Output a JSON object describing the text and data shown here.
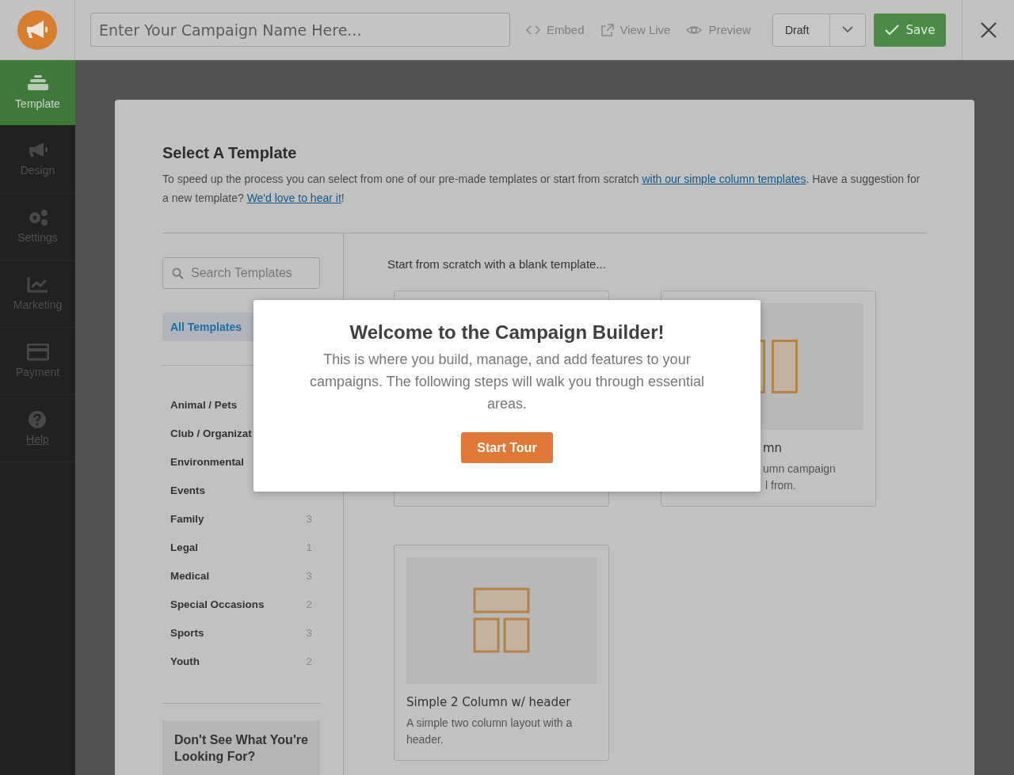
{
  "header": {
    "campaign_name": {
      "placeholder": "Enter Your Campaign Name Here..."
    },
    "actions": [
      {
        "kind": "embed",
        "label": "Embed"
      },
      {
        "kind": "view-live",
        "label": "View Live"
      },
      {
        "kind": "preview",
        "label": "Preview"
      }
    ],
    "status_select": {
      "value": "Draft"
    },
    "save_button": "Save"
  },
  "sidebar": {
    "items": [
      {
        "kind": "template",
        "label": "Template",
        "selected": true
      },
      {
        "kind": "design",
        "label": "Design",
        "selected": false
      },
      {
        "kind": "settings",
        "label": "Settings",
        "selected": false
      },
      {
        "kind": "marketing",
        "label": "Marketing",
        "selected": false
      },
      {
        "kind": "payment",
        "label": "Payment",
        "selected": false
      },
      {
        "kind": "help",
        "label": "Help",
        "selected": false
      }
    ]
  },
  "panel": {
    "title": "Select A Template",
    "intro": [
      {
        "kind": "text",
        "text": "To speed up the process you can select from one of our pre-made templates or start from scratch "
      },
      {
        "kind": "link",
        "text": "with our simple column templates"
      },
      {
        "kind": "text",
        "text": ". Have a suggestion for a new template? "
      },
      {
        "kind": "link",
        "text": "We'd love to hear it"
      },
      {
        "kind": "text",
        "text": "!"
      }
    ],
    "search": {
      "placeholder": "Search Templates"
    },
    "filters": [
      {
        "label": "All Templates",
        "selected": true
      }
    ],
    "categories": [
      {
        "label": "Animal / Pets"
      },
      {
        "label": "Club / Organizat"
      },
      {
        "label": "Environmental"
      },
      {
        "label": "Events"
      },
      {
        "label": "Family",
        "count": "3"
      },
      {
        "label": "Legal",
        "count": "1"
      },
      {
        "label": "Medical",
        "count": "3"
      },
      {
        "label": "Special Occasions",
        "count": "2"
      },
      {
        "label": "Sports",
        "count": "3"
      },
      {
        "label": "Youth",
        "count": "2"
      }
    ],
    "help_box": {
      "title": "Don't See What You're Looking For?"
    },
    "templates_intro": "Start from scratch with a blank template...",
    "templates": [
      {
        "kind": "blank"
      },
      {
        "kind": "two-column",
        "covered": true,
        "title": "mn",
        "description": [
          "umn campaign",
          "l from."
        ]
      },
      {
        "kind": "two-column-header",
        "covered": false,
        "title": "Simple 2 Column w/ header",
        "description": [
          "A simple two column layout with a",
          "header."
        ]
      }
    ]
  },
  "modal": {
    "title": "Welcome to the Campaign Builder!",
    "text": "This is where you build, manage, and add features to your campaigns. The following steps will walk you through essential areas.",
    "button": "Start Tour"
  }
}
